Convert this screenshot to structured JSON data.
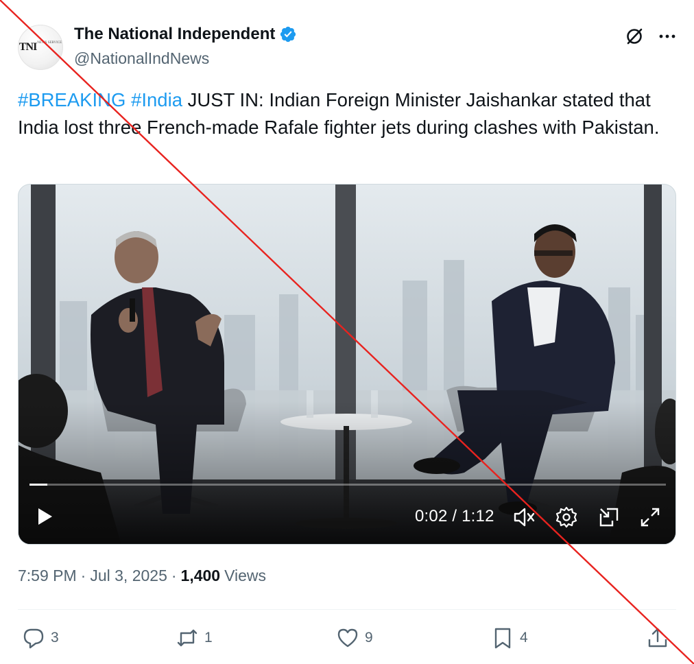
{
  "account": {
    "display_name": "The National Independent",
    "handle": "@NationalIndNews",
    "avatar_text": "TNI",
    "avatar_small_text": "NEWS SERVICE",
    "verified": true,
    "verified_color": "#1d9bf0"
  },
  "tweet": {
    "hashtags": [
      "#BREAKING",
      "#India"
    ],
    "body": " JUST IN: Indian Foreign Minister Jaishankar stated that India lost three French-made Rafale fighter jets during clashes with Pakistan."
  },
  "video": {
    "current_time": "0:02",
    "separator": " / ",
    "duration": "1:12",
    "progress": 0.028,
    "muted": true
  },
  "meta": {
    "time": "7:59 PM",
    "date": "Jul 3, 2025",
    "views_count": "1,400",
    "views_label": "Views"
  },
  "actions": {
    "replies": "3",
    "reposts": "1",
    "likes": "9",
    "bookmarks": "4"
  },
  "colors": {
    "link": "#1d9bf0",
    "text": "#0f1419",
    "muted_text": "#536471",
    "strike": "#e8231f"
  },
  "icons": [
    "verified-badge-icon",
    "grok-icon",
    "more-icon",
    "play-icon",
    "mute-icon",
    "settings-icon",
    "pip-icon",
    "fullscreen-icon",
    "reply-icon",
    "repost-icon",
    "like-icon",
    "bookmark-icon",
    "share-icon"
  ]
}
